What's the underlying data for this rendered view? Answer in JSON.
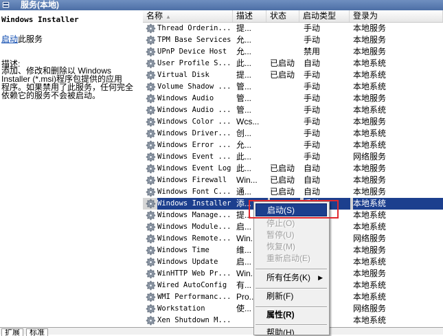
{
  "window": {
    "title": "服务(本地)"
  },
  "left_panel": {
    "service_name": "Windows Installer",
    "start_link": "启动",
    "start_suffix": "此服务",
    "description_heading": "描述:",
    "description_lines": [
      "添加、修改和删除以 Windows",
      "Installer (*.msi)程序包提供的应用",
      "程序。如果禁用了此服务，任何完全",
      "依赖它的服务不会被启动。"
    ]
  },
  "columns": {
    "name": "名称",
    "description": "描述",
    "status": "状态",
    "startup_type": "启动类型",
    "logon_as": "登录为"
  },
  "services": [
    {
      "name": "Thread Orderin...",
      "desc": "提...",
      "status": "",
      "startup": "手动",
      "logon": "本地服务"
    },
    {
      "name": "TPM Base Services",
      "desc": "允...",
      "status": "",
      "startup": "手动",
      "logon": "本地服务"
    },
    {
      "name": "UPnP Device Host",
      "desc": "允...",
      "status": "",
      "startup": "禁用",
      "logon": "本地服务"
    },
    {
      "name": "User Profile S...",
      "desc": "此...",
      "status": "已启动",
      "startup": "自动",
      "logon": "本地系统"
    },
    {
      "name": "Virtual Disk",
      "desc": "提...",
      "status": "已启动",
      "startup": "手动",
      "logon": "本地系统"
    },
    {
      "name": "Volume Shadow ...",
      "desc": "管...",
      "status": "",
      "startup": "手动",
      "logon": "本地系统"
    },
    {
      "name": "Windows Audio",
      "desc": "管...",
      "status": "",
      "startup": "手动",
      "logon": "本地服务"
    },
    {
      "name": "Windows Audio ...",
      "desc": "管...",
      "status": "",
      "startup": "手动",
      "logon": "本地系统"
    },
    {
      "name": "Windows Color ...",
      "desc": "Wcs...",
      "status": "",
      "startup": "手动",
      "logon": "本地服务"
    },
    {
      "name": "Windows Driver...",
      "desc": "创...",
      "status": "",
      "startup": "手动",
      "logon": "本地系统"
    },
    {
      "name": "Windows Error ...",
      "desc": "允...",
      "status": "",
      "startup": "手动",
      "logon": "本地系统"
    },
    {
      "name": "Windows Event ...",
      "desc": "此...",
      "status": "",
      "startup": "手动",
      "logon": "网络服务"
    },
    {
      "name": "Windows Event Log",
      "desc": "此...",
      "status": "已启动",
      "startup": "自动",
      "logon": "本地服务"
    },
    {
      "name": "Windows Firewall",
      "desc": "Win...",
      "status": "已启动",
      "startup": "自动",
      "logon": "本地服务"
    },
    {
      "name": "Windows Font C...",
      "desc": "通...",
      "status": "已启动",
      "startup": "自动",
      "logon": "本地服务"
    },
    {
      "name": "Windows Installer",
      "desc": "添...",
      "status": "",
      "startup": "手动",
      "logon": "本地系统",
      "selected": true
    },
    {
      "name": "Windows Manage...",
      "desc": "提...",
      "status": "",
      "startup": "",
      "logon": "本地系统"
    },
    {
      "name": "Windows Module...",
      "desc": "启...",
      "status": "",
      "startup": "",
      "logon": "本地系统"
    },
    {
      "name": "Windows Remote...",
      "desc": "Win...",
      "status": "",
      "startup": "",
      "logon": "网络服务"
    },
    {
      "name": "Windows Time",
      "desc": "维...",
      "status": "",
      "startup": "",
      "logon": "本地服务"
    },
    {
      "name": "Windows Update",
      "desc": "启...",
      "status": "",
      "startup": "",
      "logon": "本地系统"
    },
    {
      "name": "WinHTTP Web Pr...",
      "desc": "Win...",
      "status": "",
      "startup": "",
      "logon": "本地服务"
    },
    {
      "name": "Wired AutoConfig",
      "desc": "有...",
      "status": "",
      "startup": "",
      "logon": "本地系统"
    },
    {
      "name": "WMI Performanc...",
      "desc": "Pro...",
      "status": "",
      "startup": "",
      "logon": "本地系统"
    },
    {
      "name": "Workstation",
      "desc": "使...",
      "status": "",
      "startup": "",
      "logon": "网络服务"
    },
    {
      "name": "Xen Shutdown M...",
      "desc": "",
      "status": "",
      "startup": "",
      "logon": "本地系统"
    }
  ],
  "context_menu": {
    "start": "启动(S)",
    "stop": "停止(O)",
    "pause": "暂停(U)",
    "resume": "恢复(M)",
    "restart": "重新启动(E)",
    "all_tasks": "所有任务(K)",
    "refresh": "刷新(F)",
    "properties": "属性(R)",
    "help": "帮助(H)"
  },
  "bottom_tabs": {
    "extended": "扩展",
    "standard": "标准"
  },
  "colors": {
    "selection": "#1c3f8e",
    "highlight_box": "#e0282e",
    "title_bar": "#4d6fa6"
  }
}
